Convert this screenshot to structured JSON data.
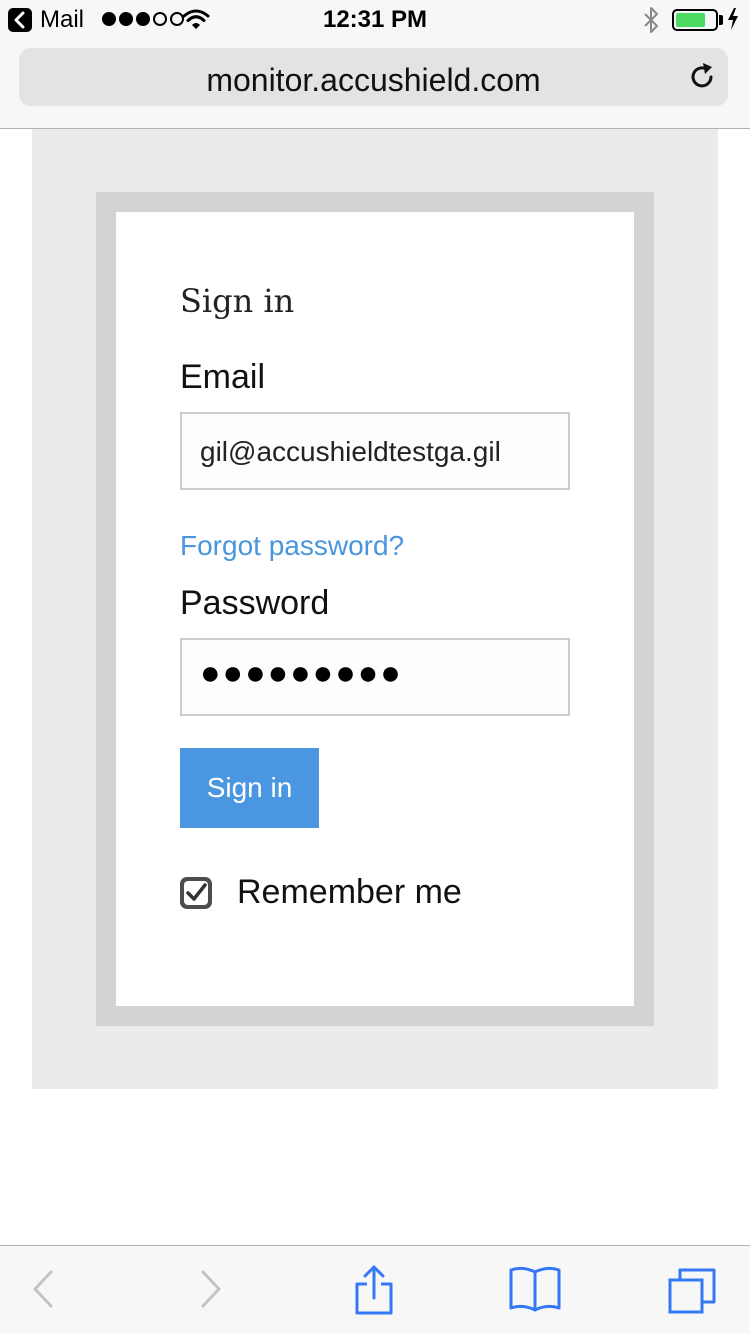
{
  "status_bar": {
    "back_app": "Mail",
    "signal": {
      "filled": 3,
      "total": 5
    },
    "time": "12:31 PM",
    "battery_level": 0.75,
    "battery_color": "#4cd964",
    "icons": [
      "back-arrow-icon",
      "wifi-icon",
      "bluetooth-icon",
      "battery-icon",
      "charging-bolt-icon"
    ]
  },
  "browser": {
    "url": "monitor.accushield.com",
    "reload_icon": "reload-icon",
    "toolbar_icons": [
      "back-icon",
      "forward-icon",
      "share-icon",
      "bookmarks-icon",
      "tabs-icon"
    ]
  },
  "form": {
    "heading": "Sign in",
    "email_label": "Email",
    "email_value": "gil@accushieldtestga.gil",
    "forgot_link": "Forgot password?",
    "password_label": "Password",
    "password_masked": "●●●●●●●●●",
    "submit_label": "Sign in",
    "remember_label": "Remember me",
    "remember_checked": true
  },
  "colors": {
    "accent": "#4a96e0",
    "link": "#4a96dd",
    "page_background": "#ebebeb",
    "card_border": "#d3d3d3"
  }
}
